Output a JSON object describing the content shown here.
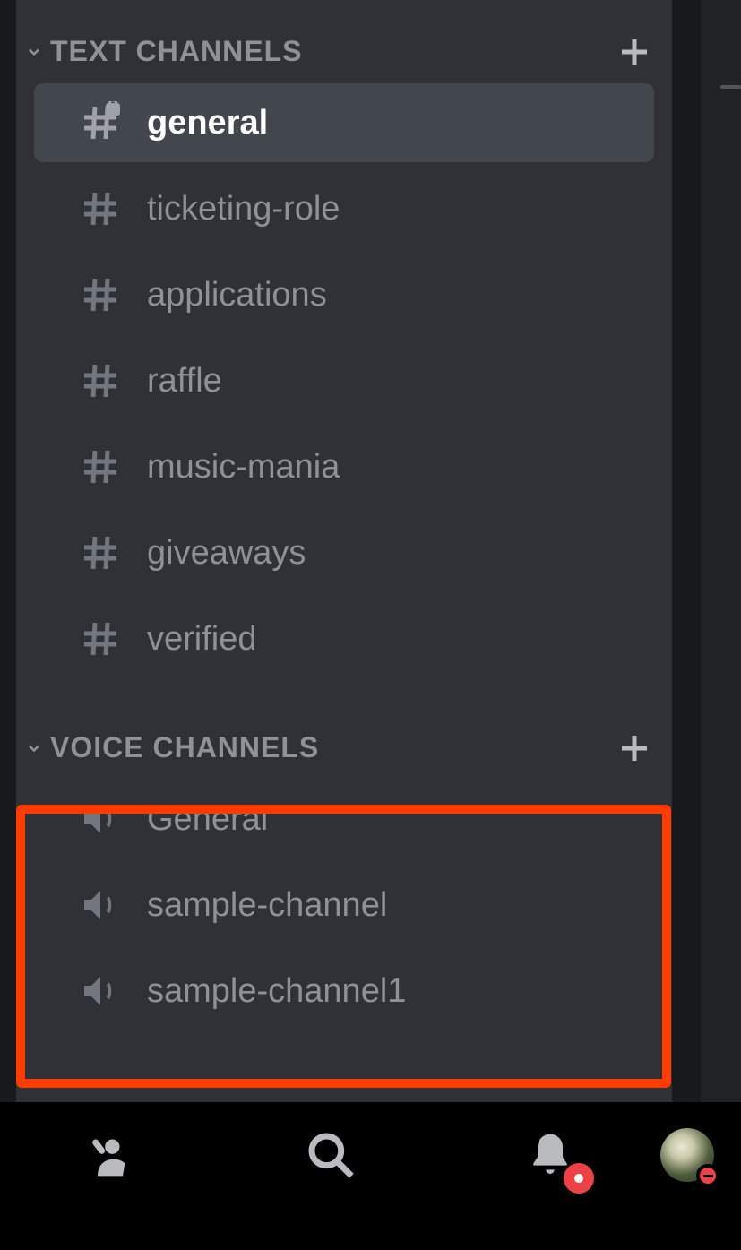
{
  "categories": {
    "text": {
      "label": "TEXT CHANNELS"
    },
    "voice": {
      "label": "VOICE CHANNELS"
    }
  },
  "text_channels": [
    {
      "name": "general",
      "locked": true,
      "selected": true
    },
    {
      "name": "ticketing-role",
      "locked": false,
      "selected": false
    },
    {
      "name": "applications",
      "locked": false,
      "selected": false
    },
    {
      "name": "raffle",
      "locked": false,
      "selected": false
    },
    {
      "name": "music-mania",
      "locked": false,
      "selected": false
    },
    {
      "name": "giveaways",
      "locked": false,
      "selected": false
    },
    {
      "name": "verified",
      "locked": false,
      "selected": false
    }
  ],
  "voice_channels": [
    {
      "name": "General"
    },
    {
      "name": "sample-channel"
    },
    {
      "name": "sample-channel1"
    }
  ]
}
